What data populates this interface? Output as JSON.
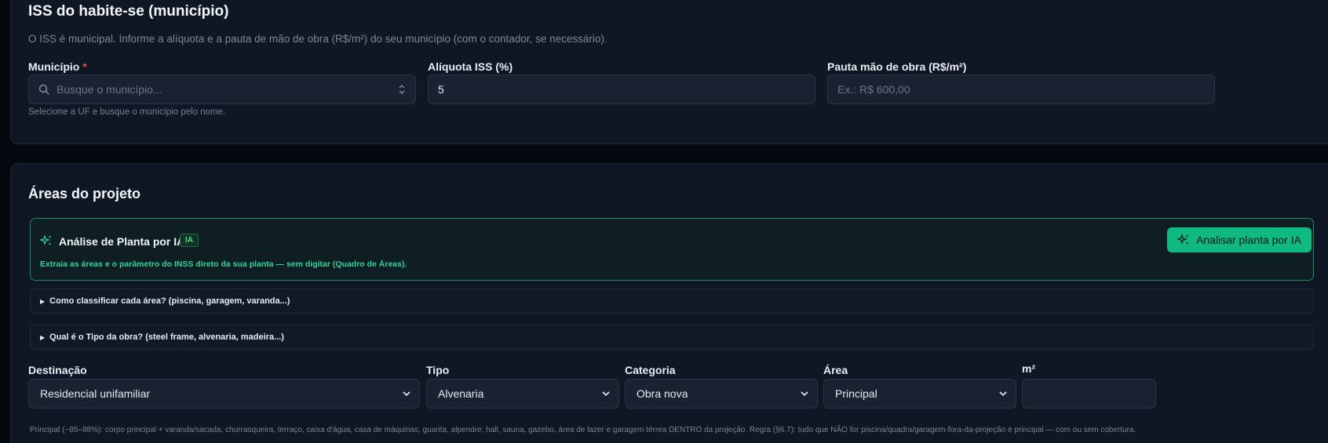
{
  "iss": {
    "title": "ISS do habite-se (município)",
    "description": "O ISS é municipal. Informe a alíquota e a pauta de mão de obra (R$/m²) do seu município (com o contador, se necessário).",
    "municipio_label": "Município",
    "required_mark": "*",
    "municipio_placeholder": "Busque o município...",
    "municipio_hint": "Selecione a UF e busque o município pelo nome.",
    "aliquota_label": "Alíquota ISS (%)",
    "aliquota_value": "5",
    "pauta_label": "Pauta mão de obra (R$/m²)",
    "pauta_placeholder": "Ex.: R$ 600,00"
  },
  "areas": {
    "title": "Áreas do projeto",
    "ai": {
      "title": "Análise de Planta por IA",
      "badge": "IA",
      "subtitle": "Extraia as áreas e o parâmetro do INSS direto da sua planta — sem digitar (Quadro de Áreas).",
      "button_label": "Analisar planta por IA"
    },
    "details": [
      "Como classificar cada área? (piscina, garagem, varanda...)",
      "Qual é o Tipo da obra? (steel frame, alvenaria, madeira...)"
    ],
    "fields": {
      "destinacao_label": "Destinação",
      "destinacao_value": "Residencial unifamiliar",
      "tipo_label": "Tipo",
      "tipo_value": "Alvenaria",
      "categoria_label": "Categoria",
      "categoria_value": "Obra nova",
      "area_label": "Área",
      "area_value": "Principal",
      "m2_label": "m²",
      "m2_value": ""
    },
    "footnote": "Principal (~85–98%): corpo principal + varanda/sacada, churrasqueira, terraço, caixa d'água, casa de máquinas, guarita, alpendre, hall, sauna, gazebo, área de lazer e garagem térrea DENTRO da projeção. Regra (§6.7): tudo que NÃO for piscina/quadra/garagem-fora-da-projeção é principal — com ou sem cobertura."
  },
  "colors": {
    "background": "#05080f",
    "card": "#0f1624",
    "accent": "#10b981",
    "required": "#ef4444"
  }
}
